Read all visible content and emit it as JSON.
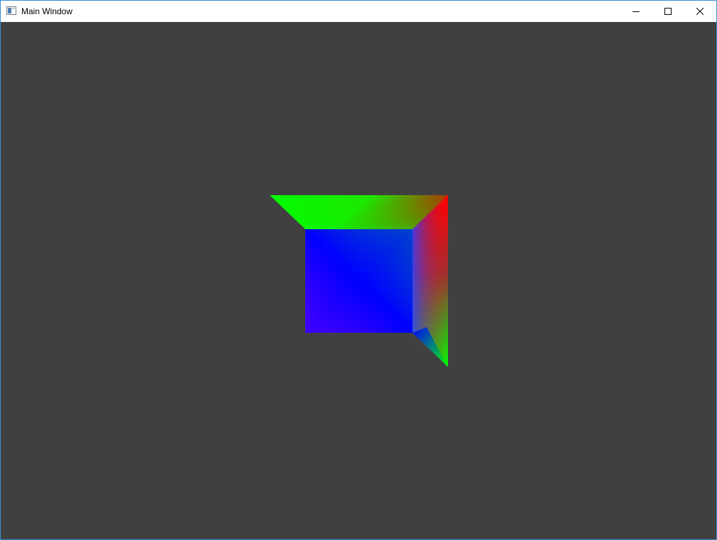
{
  "window": {
    "title": "Main Window"
  },
  "titlebar": {
    "icons": {
      "app": "app-window-icon",
      "minimize": "minimize-icon",
      "maximize": "maximize-icon",
      "close": "close-icon"
    }
  },
  "viewport": {
    "background_color": "#404040",
    "content": "rgb-gradient-cube-render",
    "vertex_colors": {
      "red": "#ff0000",
      "green": "#00ff00",
      "blue": "#0000ff",
      "magenta": "#ff00ff",
      "olive": "#808000"
    }
  }
}
